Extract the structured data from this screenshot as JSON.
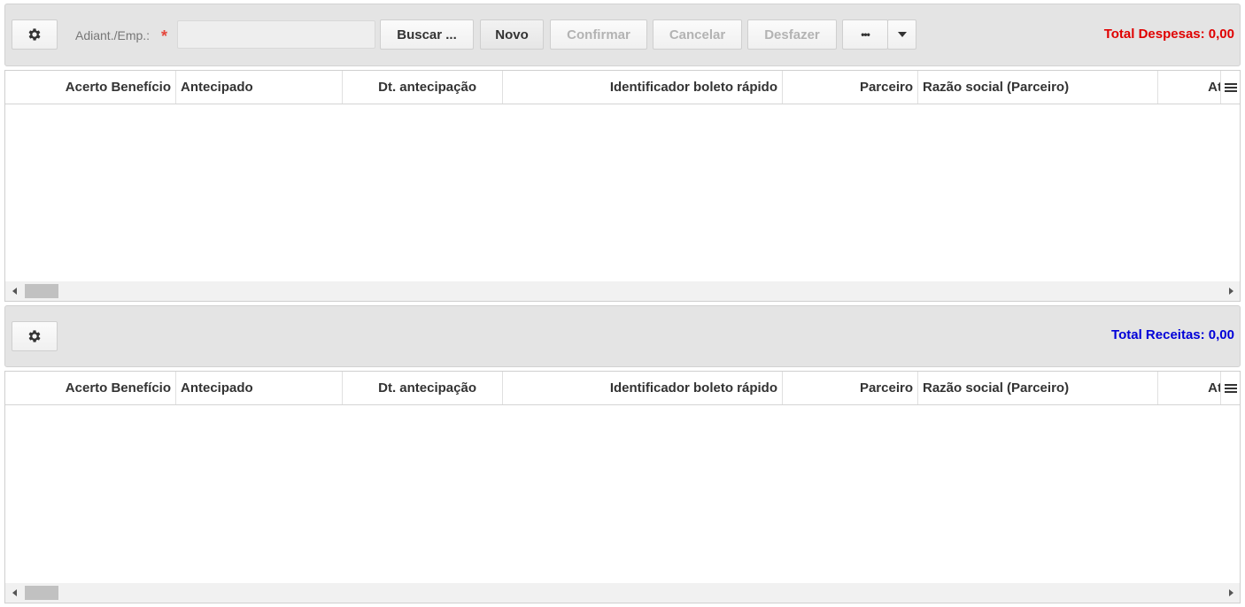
{
  "despesas": {
    "field_label": "Adiant./Emp.:",
    "required_mark": "*",
    "field_value": "",
    "buttons": {
      "buscar": "Buscar ...",
      "novo": "Novo",
      "confirmar": "Confirmar",
      "cancelar": "Cancelar",
      "desfazer": "Desfazer",
      "more": "•••"
    },
    "total": "Total Despesas: 0,00",
    "total_color": "#e00000"
  },
  "receitas": {
    "total": "Total Receitas: 0,00",
    "total_color": "#0000d8"
  },
  "columns": [
    "Acerto Benefício",
    "Antecipado",
    "Dt. antecipação",
    "Identificador boleto rápido",
    "Parceiro",
    "Razão social (Parceiro)",
    "At"
  ],
  "icons": {
    "settings": "gear-icon",
    "column_menu": "menu-icon",
    "dropdown": "caret-down-icon",
    "scroll_left": "arrow-left-icon",
    "scroll_right": "arrow-right-icon"
  }
}
